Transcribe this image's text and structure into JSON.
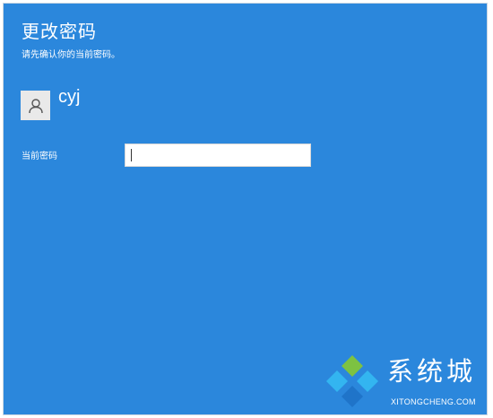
{
  "dialog": {
    "title": "更改密码",
    "subtitle": "请先确认你的当前密码。"
  },
  "account": {
    "username": "cyj",
    "avatar_icon": "user-avatar-icon"
  },
  "password": {
    "label": "当前密码",
    "value": "",
    "placeholder": ""
  },
  "watermark": {
    "chinese": "系统城",
    "english": "XITONGCHENG.COM",
    "logo_icon": "diamond-logo-icon",
    "colors": {
      "green": "#7dc242",
      "light_blue": "#33b5f0",
      "blue": "#1f74c9"
    }
  },
  "colors": {
    "background": "#2b87dc",
    "text": "#ffffff",
    "input_bg": "#ffffff"
  }
}
